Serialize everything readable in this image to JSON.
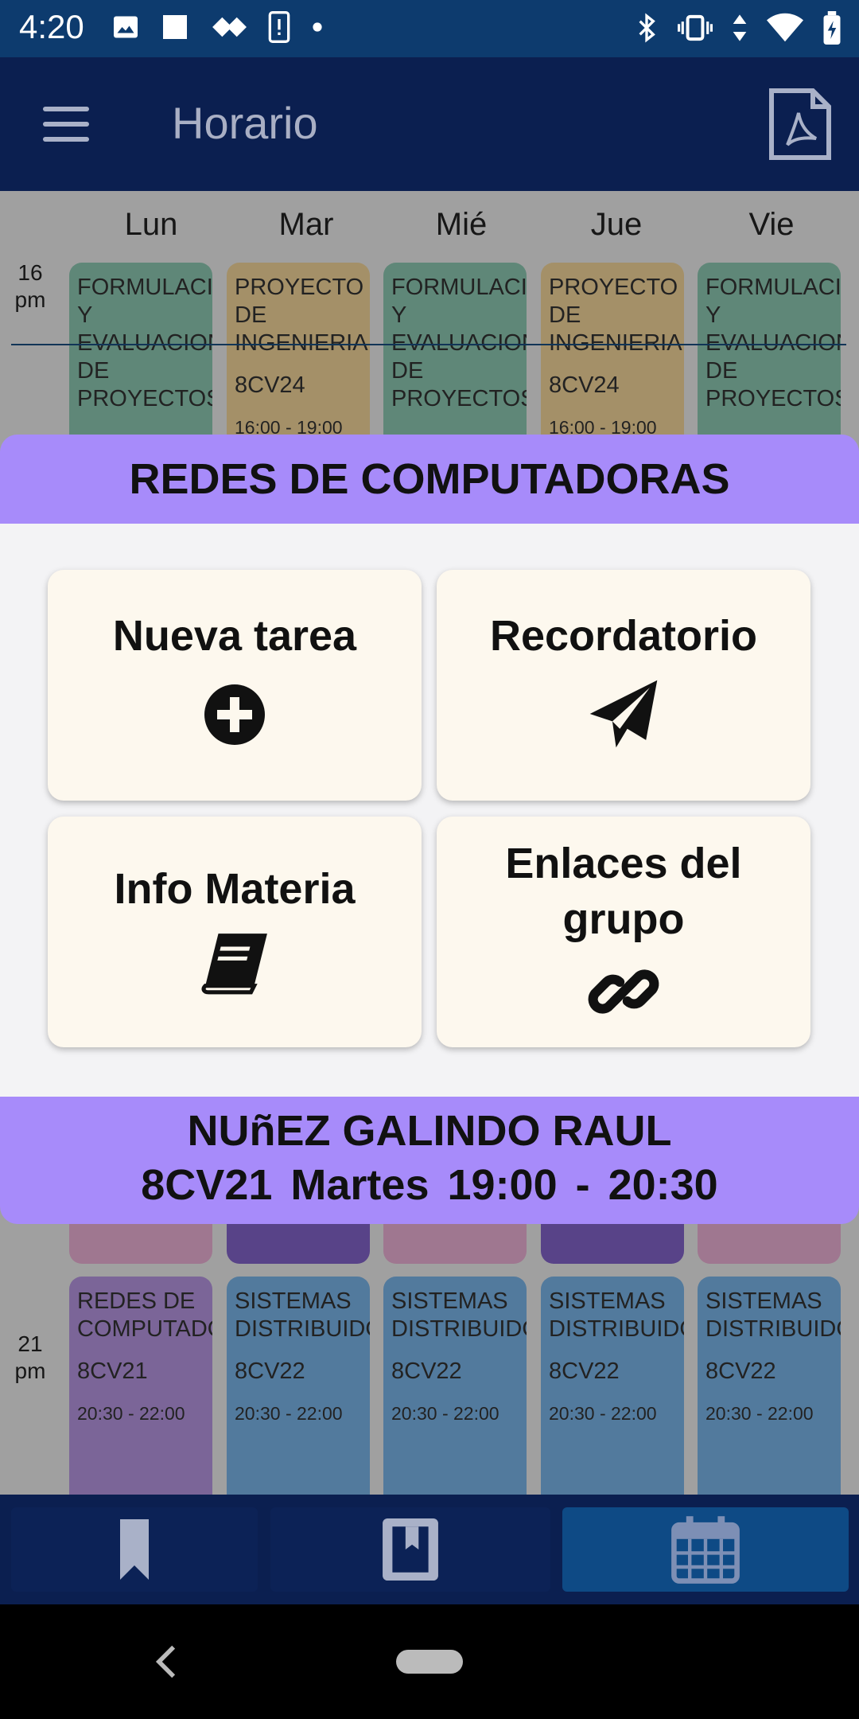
{
  "status_bar": {
    "time": "4:20"
  },
  "app_bar": {
    "title": "Horario"
  },
  "schedule": {
    "days": [
      "Lun",
      "Mar",
      "Mié",
      "Jue",
      "Vie"
    ],
    "hours": [
      {
        "num": "16",
        "suffix": "pm"
      },
      {
        "num": "21",
        "suffix": "pm"
      }
    ],
    "top_row": [
      {
        "name": "FORMULACION Y EVALUACION DE PROYECTOS",
        "code": "",
        "time": "",
        "color": "#8cc7b1"
      },
      {
        "name": "PROYECTO DE INGENIERIA",
        "code": "8CV24",
        "time": "16:00 - 19:00",
        "color": "#f2d49a"
      },
      {
        "name": "FORMULACION Y EVALUACION DE PROYECTOS",
        "code": "",
        "time": "",
        "color": "#8cc7b1"
      },
      {
        "name": "PROYECTO DE INGENIERIA",
        "code": "8CV24",
        "time": "16:00 - 19:00",
        "color": "#f2d49a"
      },
      {
        "name": "FORMULACION Y EVALUACION DE PROYECTOS",
        "code": "",
        "time": "",
        "color": "#8cc7b1"
      }
    ],
    "bottom_row": [
      {
        "name": "REDES DE COMPUTADORAS",
        "code": "8CV21",
        "time": "20:30 - 22:00",
        "color": "#b596e0"
      },
      {
        "name": "SISTEMAS DISTRIBUIDOS",
        "code": "8CV22",
        "time": "20:30 - 22:00",
        "color": "#7ab4e8"
      },
      {
        "name": "SISTEMAS DISTRIBUIDOS",
        "code": "8CV22",
        "time": "20:30 - 22:00",
        "color": "#7ab4e8"
      },
      {
        "name": "SISTEMAS DISTRIBUIDOS",
        "code": "8CV22",
        "time": "20:30 - 22:00",
        "color": "#7ab4e8"
      },
      {
        "name": "SISTEMAS DISTRIBUIDOS",
        "code": "8CV22",
        "time": "20:30 - 22:00",
        "color": "#7ab4e8"
      }
    ],
    "strip_colors": [
      "#eab0d4",
      "#8263c9",
      "#eab0d4",
      "#8263c9",
      "#eab0d4"
    ]
  },
  "modal": {
    "subject": "REDES DE COMPUTADORAS",
    "actions": {
      "new_task": "Nueva tarea",
      "reminder": "Recordatorio",
      "subject_info": "Info Materia",
      "group_links_line1": "Enlaces del",
      "group_links_line2": "grupo"
    },
    "teacher": "NUñEZ GALINDO RAUL",
    "group": "8CV21",
    "day": "Martes",
    "time_range": "19:00 - 20:30"
  },
  "colors": {
    "accent": "#a78bfa",
    "app_bar": "#0b1f50",
    "status_bar": "#0d3b6e",
    "nav_active": "#0e4a85"
  }
}
